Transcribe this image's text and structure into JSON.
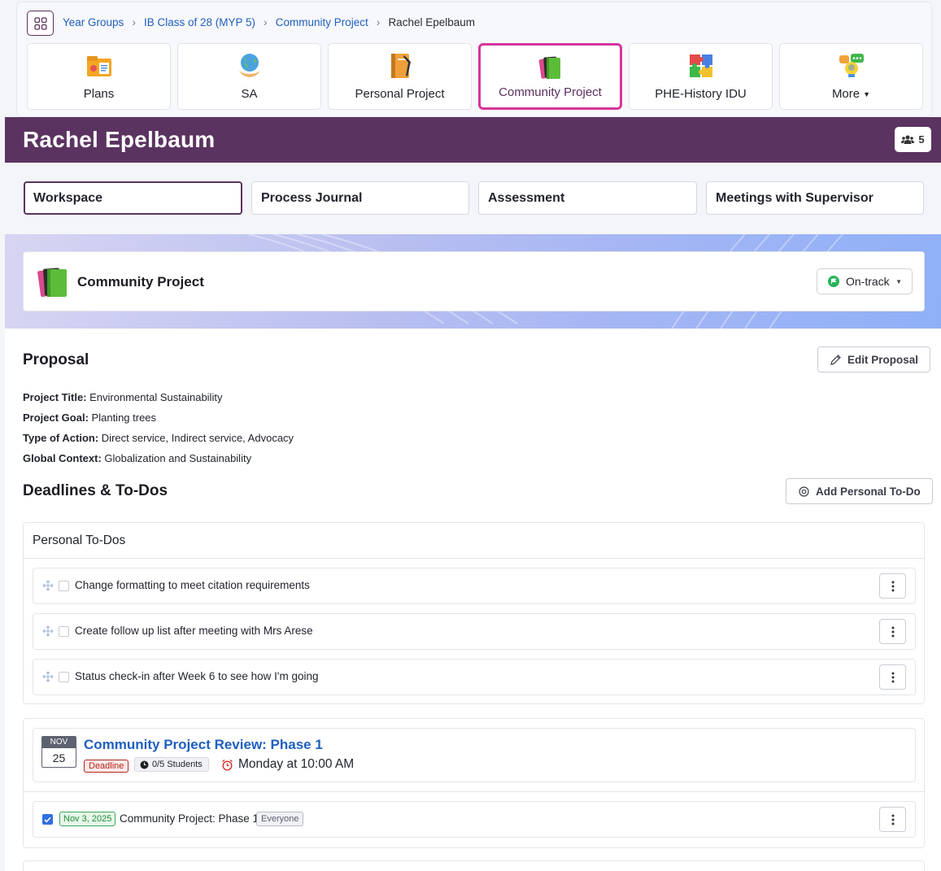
{
  "breadcrumb": {
    "items": [
      "Year Groups",
      "IB Class of 28 (MYP 5)",
      "Community Project"
    ],
    "current": "Rachel Epelbaum"
  },
  "apps": [
    {
      "label": "Plans",
      "icon": "plans-folder-icon"
    },
    {
      "label": "SA",
      "icon": "globe-hands-icon"
    },
    {
      "label": "Personal Project",
      "icon": "notebook-icon"
    },
    {
      "label": "Community Project",
      "icon": "books-icon",
      "active": true
    },
    {
      "label": "PHE-History IDU",
      "icon": "puzzle-icon"
    },
    {
      "label": "More",
      "icon": "lightbulb-chat-icon"
    }
  ],
  "header": {
    "student_name": "Rachel Epelbaum",
    "people_count": "5"
  },
  "tabs": [
    "Workspace",
    "Process Journal",
    "Assessment",
    "Meetings with Supervisor"
  ],
  "project": {
    "title": "Community Project",
    "status": "On-track"
  },
  "proposal": {
    "heading": "Proposal",
    "edit_label": "Edit Proposal",
    "fields": [
      {
        "label": "Project Title:",
        "value": "Environmental Sustainability"
      },
      {
        "label": "Project Goal:",
        "value": "Planting trees"
      },
      {
        "label": "Type of Action:",
        "value": "Direct service, Indirect service, Advocacy"
      },
      {
        "label": "Global Context:",
        "value": "Globalization and Sustainability"
      }
    ]
  },
  "deadlines": {
    "heading": "Deadlines & To-Dos",
    "add_label": "Add Personal To-Do",
    "personal_heading": "Personal To-Dos",
    "todos": [
      "Change formatting to meet citation requirements",
      "Create follow up list after meeting with Mrs Arese",
      "Status check-in after Week 6 to see how I'm going"
    ],
    "event": {
      "month": "NOV",
      "day": "25",
      "title": "Community Project Review: Phase 1",
      "badge": "Deadline",
      "students": "0/5 Students",
      "time": "Monday at 10:00 AM"
    },
    "task": {
      "date": "Nov 3, 2025",
      "text": "Community Project: Phase 1",
      "audience": "Everyone"
    }
  },
  "colors": {
    "brand_purple": "#5b3360",
    "active_tile_pink": "#d6349b",
    "link_blue": "#1f5fbf",
    "status_green": "#26b35a"
  }
}
